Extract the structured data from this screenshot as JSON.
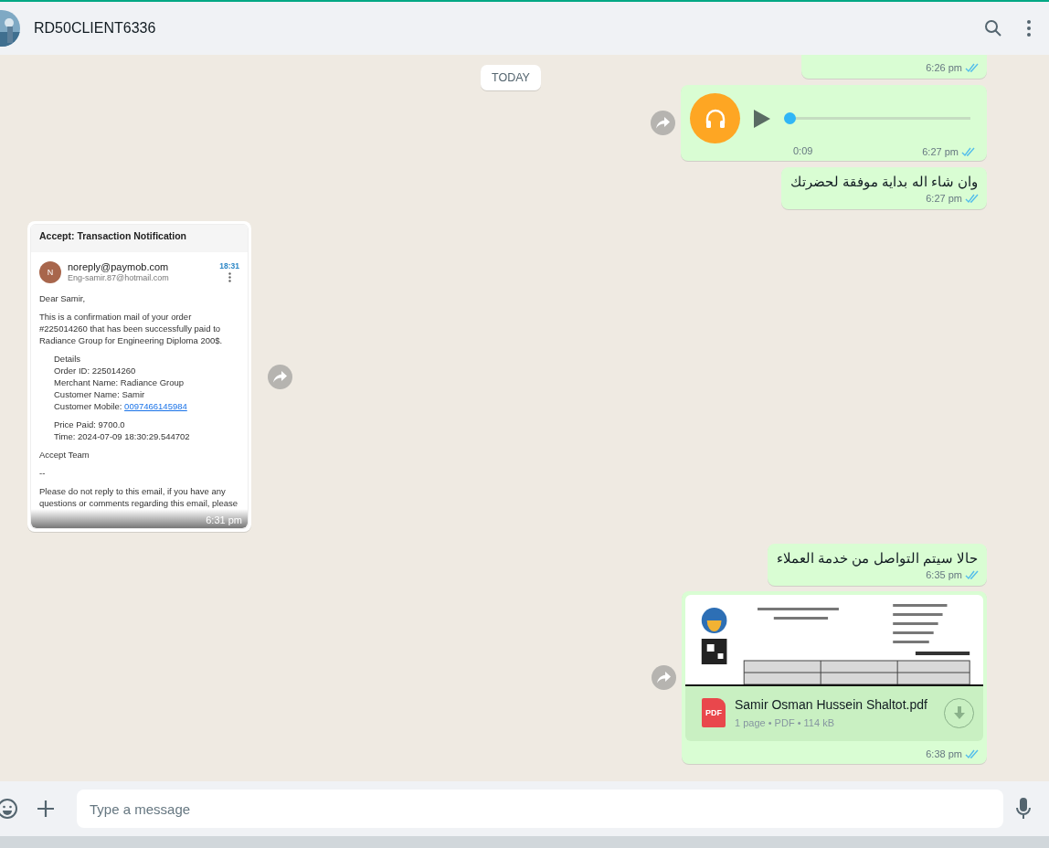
{
  "header": {
    "name": "RD50CLIENT6336"
  },
  "date_chip": "TODAY",
  "messages": [
    {
      "kind": "cut",
      "outgoing": true,
      "time": "6:26 pm",
      "read": true,
      "forward": false
    },
    {
      "kind": "audio",
      "outgoing": true,
      "time": "6:27 pm",
      "read": true,
      "forward": true,
      "duration": "0:09",
      "level": 0
    },
    {
      "kind": "text",
      "outgoing": true,
      "time": "6:27 pm",
      "read": true,
      "forward": false,
      "text": "وان شاء اله بداية موفقة لحضرتك"
    },
    {
      "kind": "email",
      "outgoing": false,
      "time": "6:31 pm",
      "forward": true,
      "email": {
        "subject": "Accept: Transaction Notification",
        "avatar_letter": "N",
        "sender": "noreply@paymob.com",
        "recipient": "Eng-samir.87@hotmail.com",
        "time": "18:31",
        "blocks": [
          {
            "kind": "para",
            "text": "Dear Samir,"
          },
          {
            "kind": "para",
            "text": "This is a confirmation mail of your order #225014260 that has been successfully paid to Radiance Group for Engineering Diploma 200$."
          },
          {
            "kind": "list",
            "lines": [
              {
                "text": "Details"
              },
              {
                "text": "Order ID: 225014260"
              },
              {
                "text": "Merchant Name: Radiance Group"
              },
              {
                "text": "Customer Name: Samir"
              },
              {
                "text": "Customer Mobile: ",
                "link": "0097466145984"
              }
            ]
          },
          {
            "kind": "list",
            "lines": [
              {
                "text": "Price Paid: 9700.0"
              },
              {
                "text": "Time: 2024-07-09 18:30:29.544702"
              }
            ]
          },
          {
            "kind": "para",
            "text": "Accept Team"
          },
          {
            "kind": "para",
            "text": "--"
          },
          {
            "kind": "para",
            "text": "Please do not reply to this email, if you have any questions or comments regarding this email, please"
          }
        ]
      }
    },
    {
      "kind": "text",
      "outgoing": true,
      "time": "6:35 pm",
      "read": true,
      "forward": false,
      "text": "حالا سيتم التواصل من خدمة العملاء"
    },
    {
      "kind": "document",
      "outgoing": true,
      "time": "6:38 pm",
      "read": true,
      "forward": true,
      "file_name": "Samir Osman Hussein Shaltot.pdf",
      "icon_label": "PDF",
      "meta": "1 page • PDF • 114 kB"
    }
  ],
  "composer": {
    "placeholder": "Type a message"
  }
}
